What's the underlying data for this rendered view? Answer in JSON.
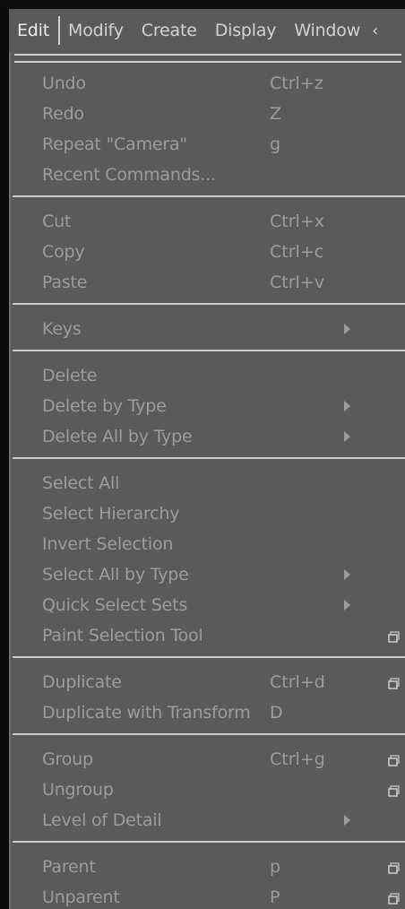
{
  "menubar": {
    "items": [
      {
        "label": "Edit",
        "active": true
      },
      {
        "label": "Modify"
      },
      {
        "label": "Create"
      },
      {
        "label": "Display"
      },
      {
        "label": "Window"
      }
    ],
    "overflow": "‹"
  },
  "dropdown": {
    "groups": [
      {
        "items": [
          {
            "label": "Undo",
            "shortcut": "Ctrl+z",
            "submenu": false,
            "option_box": false
          },
          {
            "label": "Redo",
            "shortcut": "Z",
            "submenu": false,
            "option_box": false
          },
          {
            "label": "Repeat \"Camera\"",
            "shortcut": "g",
            "submenu": false,
            "option_box": false
          },
          {
            "label": "Recent Commands...",
            "shortcut": "",
            "submenu": false,
            "option_box": false
          }
        ]
      },
      {
        "items": [
          {
            "label": "Cut",
            "shortcut": "Ctrl+x",
            "submenu": false,
            "option_box": false
          },
          {
            "label": "Copy",
            "shortcut": "Ctrl+c",
            "submenu": false,
            "option_box": false
          },
          {
            "label": "Paste",
            "shortcut": "Ctrl+v",
            "submenu": false,
            "option_box": false
          }
        ]
      },
      {
        "items": [
          {
            "label": "Keys",
            "shortcut": "",
            "submenu": true,
            "option_box": false
          }
        ]
      },
      {
        "items": [
          {
            "label": "Delete",
            "shortcut": "",
            "submenu": false,
            "option_box": false
          },
          {
            "label": "Delete by Type",
            "shortcut": "",
            "submenu": true,
            "option_box": false
          },
          {
            "label": "Delete All by Type",
            "shortcut": "",
            "submenu": true,
            "option_box": false
          }
        ]
      },
      {
        "items": [
          {
            "label": "Select All",
            "shortcut": "",
            "submenu": false,
            "option_box": false
          },
          {
            "label": "Select Hierarchy",
            "shortcut": "",
            "submenu": false,
            "option_box": false
          },
          {
            "label": "Invert Selection",
            "shortcut": "",
            "submenu": false,
            "option_box": false
          },
          {
            "label": "Select All by Type",
            "shortcut": "",
            "submenu": true,
            "option_box": false
          },
          {
            "label": "Quick Select Sets",
            "shortcut": "",
            "submenu": true,
            "option_box": false
          },
          {
            "label": "Paint Selection Tool",
            "shortcut": "",
            "submenu": false,
            "option_box": true
          }
        ]
      },
      {
        "items": [
          {
            "label": "Duplicate",
            "shortcut": "Ctrl+d",
            "submenu": false,
            "option_box": true
          },
          {
            "label": "Duplicate with Transform",
            "shortcut": "D",
            "submenu": false,
            "option_box": false
          }
        ]
      },
      {
        "items": [
          {
            "label": "Group",
            "shortcut": "Ctrl+g",
            "submenu": false,
            "option_box": true
          },
          {
            "label": "Ungroup",
            "shortcut": "",
            "submenu": false,
            "option_box": true
          },
          {
            "label": "Level of Detail",
            "shortcut": "",
            "submenu": true,
            "option_box": false
          }
        ]
      },
      {
        "items": [
          {
            "label": "Parent",
            "shortcut": "p",
            "submenu": false,
            "option_box": true
          },
          {
            "label": "Unparent",
            "shortcut": "P",
            "submenu": false,
            "option_box": true
          }
        ]
      }
    ]
  },
  "colors": {
    "menu_bg": "#5a5a5a",
    "menu_text": "#9c9c9c",
    "menubar_text": "#d2d2d2",
    "separator": "#c9c9c9",
    "outer_bg": "#0a0a0a"
  },
  "icons": {
    "submenu": "submenu-arrow-icon",
    "option_box": "option-box-icon"
  }
}
